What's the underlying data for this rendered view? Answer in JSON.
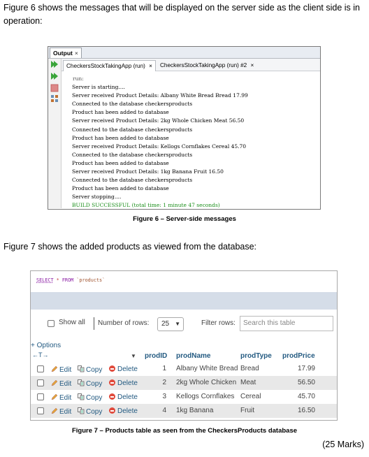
{
  "intro_fig6": "Figure 6 shows the messages that will be displayed on the server side as the client side is in operation:",
  "output_window": {
    "title": "Output",
    "close_glyph": "×",
    "tabs": [
      {
        "label": "CheckersStockTakingApp (run)",
        "close": "×"
      },
      {
        "label": "CheckersStockTakingApp (run) #2",
        "close": "×"
      }
    ],
    "lines": [
      "run:",
      "Server is starting....",
      "Server received Product Details: Albany White Bread Bread 17.99",
      "Connected to the database checkersproducts",
      "Product has been added to database",
      "Server received Product Details: 2kg Whole Chicken Meat 56.50",
      "Connected to the database checkersproducts",
      "Product has been added to database",
      "Server received Product Details: Kellogs Cornflakes Cereal 45.70",
      "Connected to the database checkersproducts",
      "Product has been added to database",
      "Server received Product Details: 1kg Banana Fruit 16.50",
      "Connected to the database checkersproducts",
      "Product has been added to database",
      "Server stopping....",
      "BUILD SUCCESSFUL (total time: 1 minute 47 seconds)"
    ],
    "icons": [
      "run-again-icon",
      "run-icon",
      "stop-icon",
      "settings-icon"
    ]
  },
  "caption_fig6": "Figure 6 – Server-side messages",
  "intro_fig7": "Figure 7 shows the added products as viewed from the database:",
  "pma": {
    "sql_select": "SELECT",
    "sql_star": "*",
    "sql_from": "FROM",
    "sql_table": "`products`",
    "show_all": "Show all",
    "rows_label": "Number of rows:",
    "rows_value": "25",
    "filter_label": "Filter rows:",
    "search_placeholder": "Search this table",
    "options": "+ Options",
    "sorter": "←T→",
    "columns": [
      "prodID",
      "prodName",
      "prodType",
      "prodPrice"
    ],
    "actions": {
      "edit": "Edit",
      "copy": "Copy",
      "delete": "Delete"
    },
    "rows": [
      {
        "id": "1",
        "name": "Albany White Bread",
        "type": "Bread",
        "price": "17.99"
      },
      {
        "id": "2",
        "name": "2kg Whole Chicken",
        "type": "Meat",
        "price": "56.50"
      },
      {
        "id": "3",
        "name": "Kellogs Cornflakes",
        "type": "Cereal",
        "price": "45.70"
      },
      {
        "id": "4",
        "name": "1kg Banana",
        "type": "Fruit",
        "price": "16.50"
      }
    ],
    "accent": "#235a81",
    "stripe": "#d5dde8"
  },
  "caption_fig7": "Figure 7 – Products table as seen from the CheckersProducts database",
  "marks": "(25 Marks)"
}
